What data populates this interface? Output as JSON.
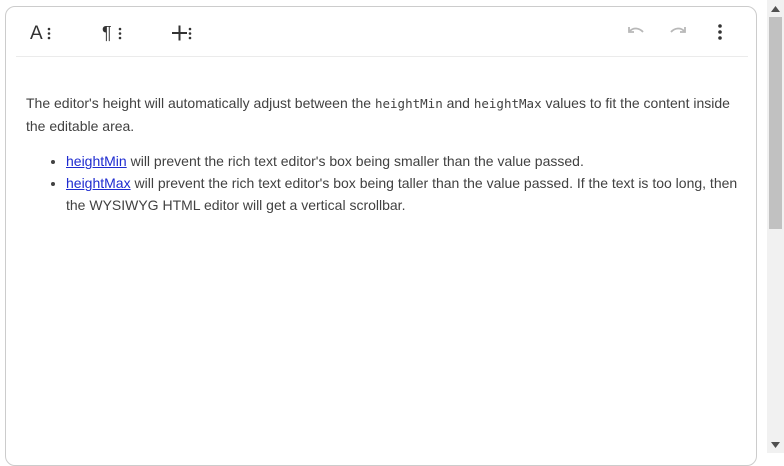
{
  "toolbar": {
    "text_format_icon": "text-format-icon",
    "paragraph_format_icon": "paragraph-format-icon",
    "insert_icon": "insert-icon",
    "undo_icon": "undo-icon",
    "redo_icon": "redo-icon",
    "more_icon": "more-vertical-icon"
  },
  "content": {
    "intro": {
      "part1": "The editor's height will automatically adjust between the ",
      "code1": "heightMin",
      "part2": " and ",
      "code2": "heightMax",
      "part3": " values to fit the content inside the editable area."
    },
    "items": [
      {
        "link": "heightMin",
        "text": " will prevent the rich text editor's box being smaller than the value passed."
      },
      {
        "link": "heightMax",
        "text": " will prevent the rich text editor's box being taller than the value passed. If the text is too long, then the WYSIWYG HTML editor will get a vertical scrollbar."
      }
    ]
  },
  "colors": {
    "text": "#414141",
    "link": "#1e2bd0",
    "border": "#cccccc",
    "disabled_icon": "#b8b8b8"
  }
}
